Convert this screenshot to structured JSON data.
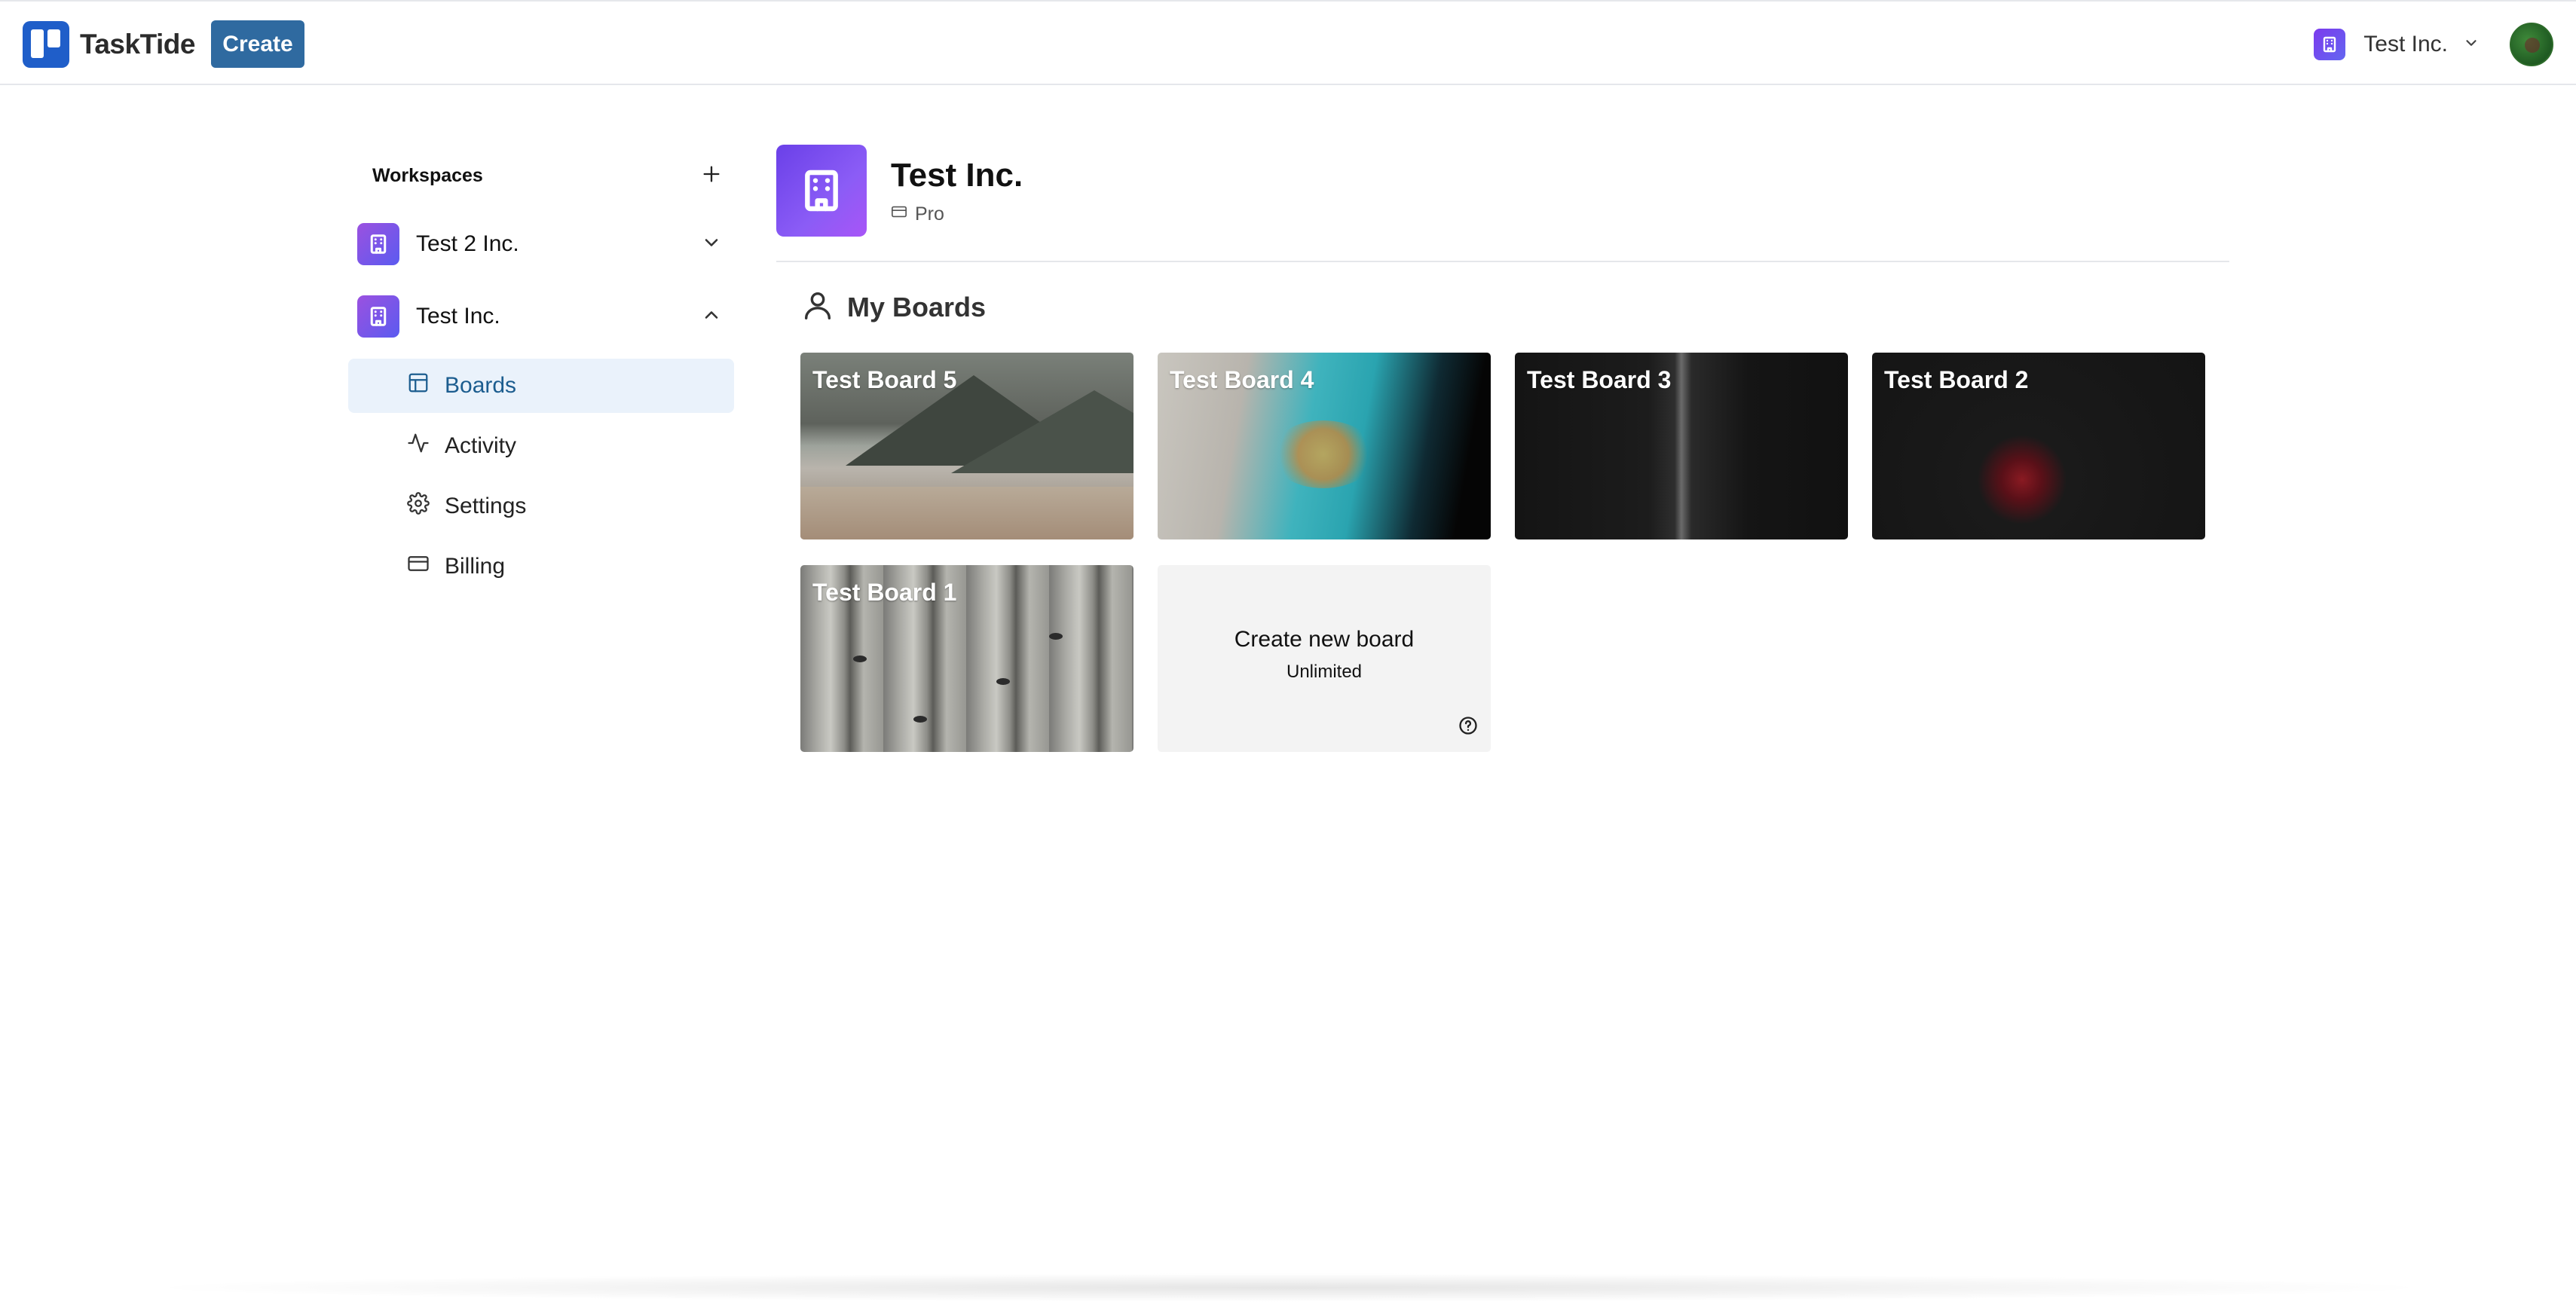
{
  "app": {
    "name": "TaskTide",
    "create_label": "Create"
  },
  "header": {
    "workspace_switcher_label": "Test Inc."
  },
  "sidebar": {
    "heading": "Workspaces",
    "workspaces": [
      {
        "name": "Test 2 Inc.",
        "expanded": false
      },
      {
        "name": "Test Inc.",
        "expanded": true
      }
    ],
    "sub_items": [
      {
        "label": "Boards",
        "icon": "layout-icon",
        "active": true
      },
      {
        "label": "Activity",
        "icon": "activity-icon",
        "active": false
      },
      {
        "label": "Settings",
        "icon": "gear-icon",
        "active": false
      },
      {
        "label": "Billing",
        "icon": "credit-card-icon",
        "active": false
      }
    ]
  },
  "main": {
    "workspace_title": "Test Inc.",
    "plan": "Pro",
    "section_title": "My Boards",
    "boards": [
      {
        "title": "Test Board 5"
      },
      {
        "title": "Test Board 4"
      },
      {
        "title": "Test Board 3"
      },
      {
        "title": "Test Board 2"
      },
      {
        "title": "Test Board 1"
      }
    ],
    "create_board": {
      "label": "Create new board",
      "sub": "Unlimited"
    }
  },
  "colors": {
    "brand": "#1f5ec9",
    "create_button": "#2f6aa0",
    "active_item_bg": "#eaf2fb",
    "active_item_text": "#1c5d8f",
    "workspace_badge": "#7c3aed"
  }
}
